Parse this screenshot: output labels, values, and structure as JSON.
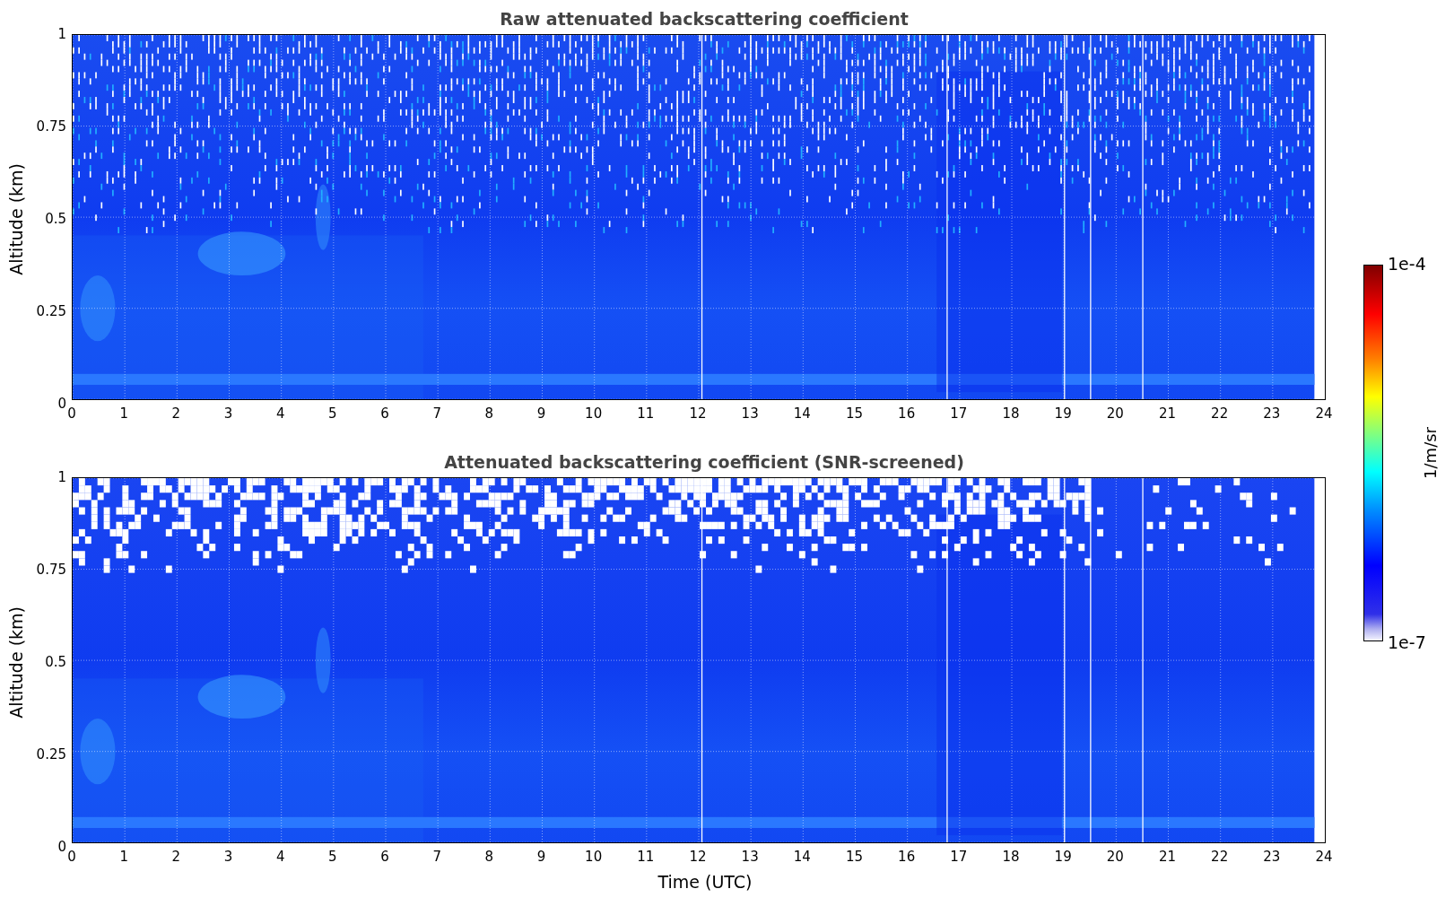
{
  "panels": [
    {
      "kind": "raw",
      "title": "Raw attenuated backscattering coefficient",
      "ylabel": "Altitude (km)",
      "yticks": [
        "1",
        "0.75",
        "0.5",
        "0.25",
        "0"
      ],
      "xticks": [
        "0",
        "1",
        "2",
        "3",
        "4",
        "5",
        "6",
        "7",
        "8",
        "9",
        "10",
        "11",
        "12",
        "13",
        "14",
        "15",
        "16",
        "17",
        "18",
        "19",
        "20",
        "21",
        "22",
        "23",
        "24"
      ]
    },
    {
      "kind": "screened",
      "title": "Attenuated backscattering coefficient (SNR-screened)",
      "ylabel": "Altitude (km)",
      "yticks": [
        "1",
        "0.75",
        "0.5",
        "0.25",
        "0"
      ],
      "xticks": [
        "0",
        "1",
        "2",
        "3",
        "4",
        "5",
        "6",
        "7",
        "8",
        "9",
        "10",
        "11",
        "12",
        "13",
        "14",
        "15",
        "16",
        "17",
        "18",
        "19",
        "20",
        "21",
        "22",
        "23",
        "24"
      ]
    }
  ],
  "xlabel": "Time (UTC)",
  "colorbar": {
    "label": "1/m/sr",
    "max": "1e-4",
    "min": "1e-7"
  }
}
